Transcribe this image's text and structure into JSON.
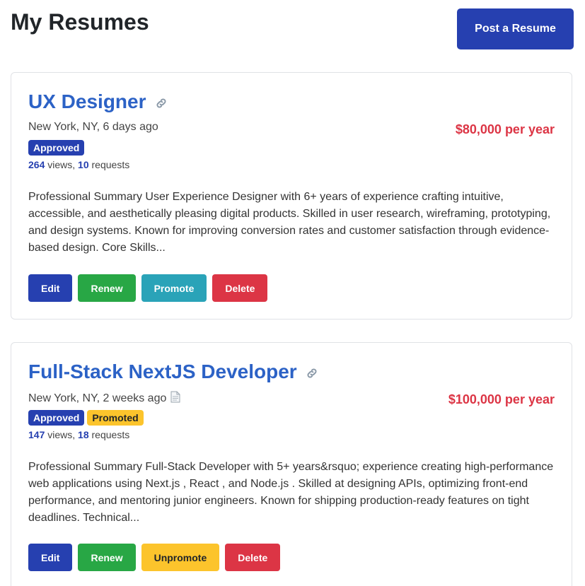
{
  "header": {
    "title": "My Resumes",
    "post_button_label": "Post a Resume"
  },
  "colors": {
    "primary": "#2640b0",
    "link": "#2c62c6",
    "salary": "#dc3545",
    "renew": "#28a745",
    "promote": "#2aa3b8",
    "warning": "#fcc42c",
    "danger": "#dc3545"
  },
  "resumes": [
    {
      "title": "UX Designer",
      "title_icon": "link-icon",
      "meta": "New York, NY, 6 days ago",
      "salary": "$80,000 per year",
      "badges": [
        "Approved"
      ],
      "views": "264",
      "views_label": " views, ",
      "requests": "10",
      "requests_label": " requests",
      "summary": "Professional Summary User Experience Designer with 6+ years of experience crafting intuitive, accessible, and aesthetically pleasing digital products. Skilled in user research, wireframing, prototyping, and design systems. Known for improving conversion rates and customer satisfaction through evidence-based design. Core Skills...",
      "actions": [
        "Edit",
        "Renew",
        "Promote",
        "Delete"
      ]
    },
    {
      "title": "Full-Stack NextJS Developer",
      "title_icon": "link-icon",
      "meta": "New York, NY, 2 weeks ago",
      "meta_icon": "document-icon",
      "salary": "$100,000 per year",
      "badges": [
        "Approved",
        "Promoted"
      ],
      "views": "147",
      "views_label": " views, ",
      "requests": "18",
      "requests_label": " requests",
      "summary": "Professional Summary Full-Stack Developer with 5+ years&rsquo; experience creating high-performance web applications using Next.js , React , and Node.js . Skilled at designing APIs, optimizing front-end performance, and mentoring junior engineers. Known for shipping production-ready features on tight deadlines. Technical...",
      "actions": [
        "Edit",
        "Renew",
        "Unpromote",
        "Delete"
      ]
    }
  ]
}
